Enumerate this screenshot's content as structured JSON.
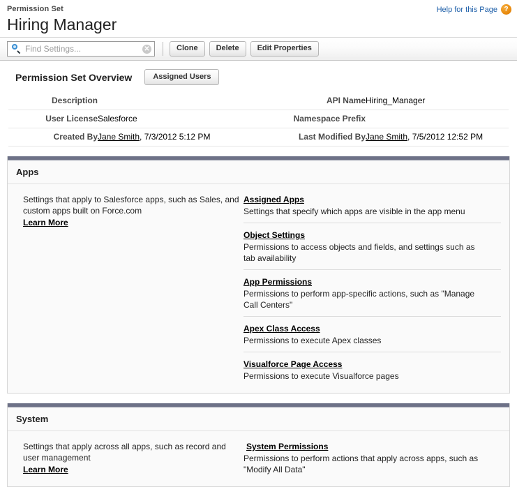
{
  "header": {
    "eyebrow": "Permission Set",
    "title": "Hiring Manager",
    "help_label": "Help for this Page",
    "help_icon_glyph": "?",
    "help_icon_color": "#e8890c",
    "help_link_color": "#1c5ea8"
  },
  "toolbar": {
    "search_placeholder": "Find Settings...",
    "search_value": "",
    "clear_glyph": "✕",
    "buttons": [
      {
        "label": "Clone"
      },
      {
        "label": "Delete"
      },
      {
        "label": "Edit Properties"
      }
    ]
  },
  "overview": {
    "title": "Permission Set Overview",
    "assigned_users_label": "Assigned Users",
    "rows": [
      {
        "left_label": "Description",
        "left_value": "",
        "right_label": "API Name",
        "right_value": "Hiring_Manager"
      },
      {
        "left_label": "User License",
        "left_value": "Salesforce",
        "right_label": "Namespace Prefix",
        "right_value": ""
      },
      {
        "left_label": "Created By",
        "left_link": "Jane Smith",
        "left_value": ", 7/3/2012 5:12 PM",
        "right_label": "Last Modified By",
        "right_link": "Jane Smith",
        "right_value": ", 7/5/2012 12:52 PM"
      }
    ]
  },
  "panels": [
    {
      "name": "apps",
      "heading": "Apps",
      "description": "Settings that apply to Salesforce apps, such as Sales, and custom apps built on Force.com",
      "learn_more": "Learn More",
      "links": [
        {
          "title": "Assigned Apps",
          "desc": "Settings that specify which apps are visible in the app menu"
        },
        {
          "title": "Object Settings",
          "desc": "Permissions to access objects and fields, and settings such as tab availability"
        },
        {
          "title": "App Permissions",
          "desc": "Permissions to perform app-specific actions, such as \"Manage Call Centers\""
        },
        {
          "title": "Apex Class Access",
          "desc": "Permissions to execute Apex classes"
        },
        {
          "title": "Visualforce Page Access",
          "desc": "Permissions to execute Visualforce pages"
        }
      ]
    },
    {
      "name": "system",
      "heading": "System",
      "description": "Settings that apply across all apps, such as record and user management",
      "learn_more": "Learn More",
      "links": [
        {
          "title": "System Permissions",
          "desc": "Permissions to perform actions that apply across apps, such as \"Modify All Data\""
        }
      ]
    }
  ],
  "colors": {
    "panel_topbar": "#6d7187",
    "panel_body": "#fafafa",
    "link_blue": "#1c5ea8"
  }
}
